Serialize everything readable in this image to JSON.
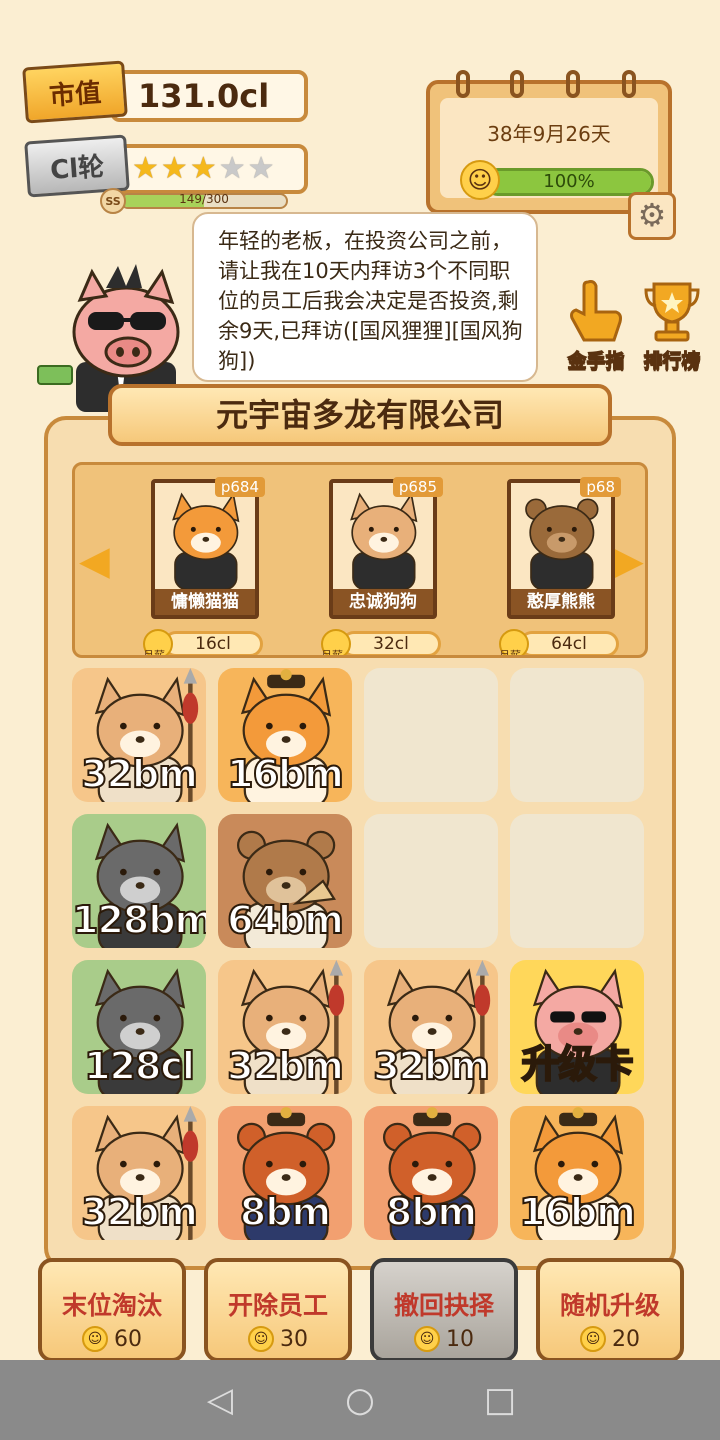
{
  "stats": {
    "market_value_label": "市值",
    "market_value": "131.0cl",
    "round_label": "Cl轮",
    "stars_total": 5,
    "stars_filled": 3,
    "level_badge": "SS",
    "xp_text": "149/300",
    "xp_progress": 0.497
  },
  "calendar": {
    "date": "38年9月26天",
    "mood_percent": "100%",
    "mood_progress": 1.0
  },
  "dialog": {
    "text": "年轻的老板，在投资公司之前，请让我在10天内拜访3个不同职位的员工后我会决定是否投资,剩余9天,已拜访([国风狸狸][国风狗狗])"
  },
  "side_buttons": [
    {
      "label": "金手指",
      "icon": "pointing-hand-icon"
    },
    {
      "label": "排行榜",
      "icon": "trophy-icon"
    }
  ],
  "company": {
    "name": "元宇宙多龙有限公司"
  },
  "candidates": [
    {
      "id": "p684",
      "name": "慵懒猫猫",
      "salary_label": "月薪",
      "salary": "16cl",
      "animal": "cat"
    },
    {
      "id": "p685",
      "name": "忠诚狗狗",
      "salary_label": "月薪",
      "salary": "32cl",
      "animal": "dog"
    },
    {
      "id": "p68",
      "name": "憨厚熊熊",
      "salary_label": "月薪",
      "salary": "64cl",
      "animal": "bear"
    }
  ],
  "grid": [
    {
      "label": "32bm",
      "animal": "dog-spear",
      "bg": "#f6c68a"
    },
    {
      "label": "16bm",
      "animal": "cat-official",
      "bg": "#f7b55a"
    },
    {
      "label": "",
      "animal": "empty",
      "bg": ""
    },
    {
      "label": "",
      "animal": "empty",
      "bg": ""
    },
    {
      "label": "128bm",
      "animal": "wolf",
      "bg": "#a9cc8a"
    },
    {
      "label": "64bm",
      "animal": "bear-scholar",
      "bg": "#c98a5a"
    },
    {
      "label": "",
      "animal": "empty",
      "bg": ""
    },
    {
      "label": "",
      "animal": "empty",
      "bg": ""
    },
    {
      "label": "128cl",
      "animal": "wolf",
      "bg": "#a9cc8a"
    },
    {
      "label": "32bm",
      "animal": "dog-spear",
      "bg": "#f6c68a"
    },
    {
      "label": "32bm",
      "animal": "dog-spear",
      "bg": "#f6c68a"
    },
    {
      "label": "升级卡",
      "animal": "pig-boss",
      "bg": "#ffd75a"
    },
    {
      "label": "32bm",
      "animal": "dog-spear",
      "bg": "#f6c68a"
    },
    {
      "label": "8bm",
      "animal": "red-panda",
      "bg": "#f2a070"
    },
    {
      "label": "8bm",
      "animal": "red-panda",
      "bg": "#f2a070"
    },
    {
      "label": "16bm",
      "animal": "cat-official",
      "bg": "#f7b55a"
    }
  ],
  "bottom_buttons": [
    {
      "label": "末位淘汰",
      "cost": "60",
      "style": "normal"
    },
    {
      "label": "开除员工",
      "cost": "30",
      "style": "normal"
    },
    {
      "label": "撤回抉择",
      "cost": "10",
      "style": "dark"
    },
    {
      "label": "随机升级",
      "cost": "20",
      "style": "normal"
    }
  ],
  "navbar": {
    "back_icon": "back-triangle-icon",
    "home_icon": "home-circle-icon",
    "recents_icon": "recents-square-icon"
  }
}
